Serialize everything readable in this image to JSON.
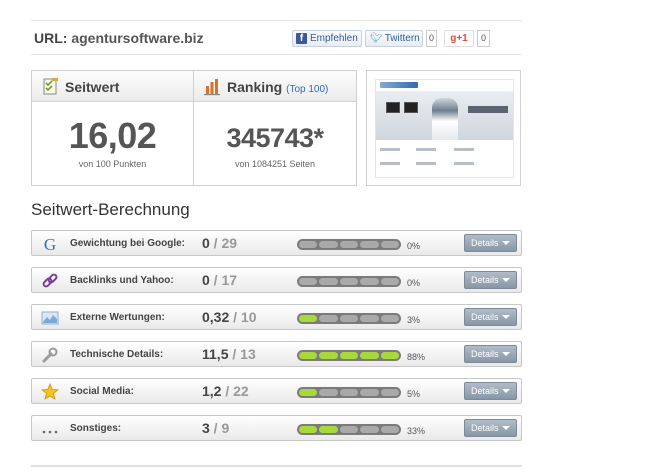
{
  "url_bar": {
    "label": "URL:",
    "domain": "agentursoftware.biz"
  },
  "social": {
    "facebook_label": "Empfehlen",
    "facebook_count": "0",
    "twitter_label": "Twittern",
    "twitter_count": "0",
    "gplus_label": "+1",
    "gplus_count": "0"
  },
  "seitwert_box": {
    "title": "Seitwert",
    "value": "16,02",
    "subtitle": "von 100 Punkten",
    "icon": "checklist-icon"
  },
  "ranking_box": {
    "title": "Ranking",
    "title_small": "(Top 100)",
    "value": "345743*",
    "subtitle": "von 1084251 Seiten",
    "icon": "bar-chart-icon"
  },
  "section_title": "Seitwert-Berechnung",
  "details_label": "Details",
  "accent": {
    "bar_on": "#a8d93a",
    "bar_off": "#a9a9a9",
    "button": "#8796a6"
  },
  "rows": [
    {
      "icon": "google-icon",
      "label": "Gewichtung bei Google:",
      "score": "0",
      "max": "/ 29",
      "percent": "0%",
      "filled": 0
    },
    {
      "icon": "link-icon",
      "label": "Backlinks und Yahoo:",
      "score": "0",
      "max": "/ 17",
      "percent": "0%",
      "filled": 0
    },
    {
      "icon": "chart-area-icon",
      "label": "Externe Wertungen:",
      "score": "0,32",
      "max": "/ 10",
      "percent": "3%",
      "filled": 1
    },
    {
      "icon": "wrench-icon",
      "label": "Technische Details:",
      "score": "11,5",
      "max": "/ 13",
      "percent": "88%",
      "filled": 5
    },
    {
      "icon": "star-icon",
      "label": "Social Media:",
      "score": "1,2",
      "max": "/ 22",
      "percent": "5%",
      "filled": 1
    },
    {
      "icon": "more-dots-icon",
      "label": "Sonstiges:",
      "score": "3",
      "max": "/ 9",
      "percent": "33%",
      "filled": 2
    }
  ]
}
